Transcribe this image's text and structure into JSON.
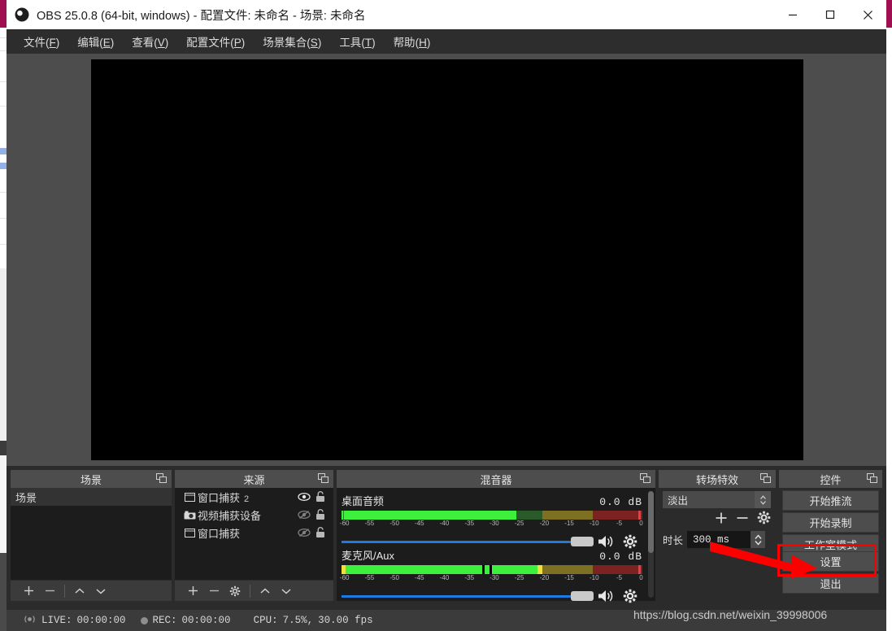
{
  "window": {
    "title": "OBS 25.0.8 (64-bit, windows) - 配置文件: 未命名 - 场景: 未命名",
    "app_icon": "obs-logo-icon",
    "minimize_label": "最小化",
    "maximize_label": "最大化",
    "close_label": "关闭"
  },
  "menubar": {
    "items": [
      {
        "label": "文件",
        "accel": "F"
      },
      {
        "label": "编辑",
        "accel": "E"
      },
      {
        "label": "查看",
        "accel": "V"
      },
      {
        "label": "配置文件",
        "accel": "P"
      },
      {
        "label": "场景集合",
        "accel": "S"
      },
      {
        "label": "工具",
        "accel": "T"
      },
      {
        "label": "帮助",
        "accel": "H"
      }
    ]
  },
  "docks": {
    "scenes": {
      "title": "场景",
      "items": [
        {
          "label": "场景",
          "selected": true
        }
      ],
      "toolbar": [
        {
          "icon": "plus-icon",
          "label": "添加场景"
        },
        {
          "icon": "minus-icon",
          "label": "移除场景"
        },
        {
          "icon": "chevron-up-icon",
          "label": "上移"
        },
        {
          "icon": "chevron-down-icon",
          "label": "下移"
        }
      ]
    },
    "sources": {
      "title": "来源",
      "items": [
        {
          "icon": "window-capture-icon",
          "name": "窗口捕获",
          "suffix": "2",
          "visible": true,
          "locked": false
        },
        {
          "icon": "camera-icon",
          "name": "视频捕获设备",
          "suffix": "",
          "visible": false,
          "locked": false
        },
        {
          "icon": "window-capture-icon",
          "name": "窗口捕获",
          "suffix": "",
          "visible": false,
          "locked": false
        }
      ],
      "toolbar": [
        {
          "icon": "plus-icon",
          "label": "添加来源"
        },
        {
          "icon": "minus-icon",
          "label": "移除来源"
        },
        {
          "icon": "gear-icon",
          "label": "来源属性"
        },
        {
          "icon": "chevron-up-icon",
          "label": "上移"
        },
        {
          "icon": "chevron-down-icon",
          "label": "下移"
        }
      ]
    },
    "mixer": {
      "title": "混音器",
      "scale_ticks": [
        "-60",
        "-55",
        "-50",
        "-45",
        "-40",
        "-35",
        "-30",
        "-25",
        "-20",
        "-15",
        "-10",
        "-5",
        "0"
      ],
      "channels": [
        {
          "name": "桌面音频",
          "db": "0.0 dB",
          "level_pct": 58,
          "peak_pct": 58,
          "volume_pct": 100,
          "muted": false
        },
        {
          "name": "麦克风/Aux",
          "db": "0.0 dB",
          "level_pct": 67,
          "peak_pct": 47,
          "volume_pct": 100,
          "muted": false
        }
      ]
    },
    "transitions": {
      "title": "转场特效",
      "selected": "淡出",
      "add_label": "添加转场",
      "remove_label": "移除转场",
      "props_label": "转场属性",
      "duration_label": "时长",
      "duration_value": "300 ms"
    },
    "controls": {
      "title": "控件",
      "buttons": [
        {
          "label": "开始推流",
          "name": "start-streaming-button"
        },
        {
          "label": "开始录制",
          "name": "start-recording-button"
        },
        {
          "label": "工作室模式",
          "name": "studio-mode-button"
        },
        {
          "label": "设置",
          "name": "settings-button",
          "highlighted": true
        },
        {
          "label": "退出",
          "name": "exit-button"
        }
      ]
    }
  },
  "statusbar": {
    "live_icon": "broadcast-icon",
    "live_label": "LIVE:",
    "live_time": "00:00:00",
    "rec_icon": "record-dot-icon",
    "rec_label": "REC:",
    "rec_time": "00:00:00",
    "cpu_label": "CPU:",
    "cpu_value": "7.5%,",
    "fps_value": "30.00 fps"
  },
  "annotation": {
    "arrow_color": "#fc0000",
    "box_color": "#fc0000",
    "target": "设置"
  },
  "watermark": {
    "text": "https://blog.csdn.net/weixin_39998006"
  },
  "colors": {
    "accent": "#1f7ae0",
    "panel": "#2b2b2b",
    "panel_header": "#4d4d4d",
    "list_bg": "#1c1c1c",
    "meter_green": "#3cf03c",
    "meter_yellow": "#f0e03c",
    "meter_red": "#f03c3c",
    "annotation_red": "#fc0000",
    "titlebar": "#ffffff"
  }
}
